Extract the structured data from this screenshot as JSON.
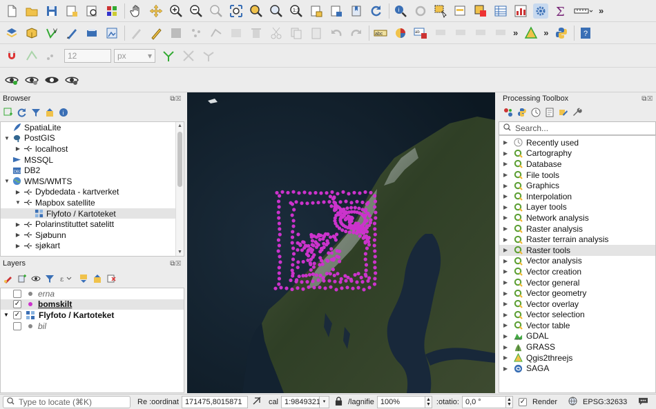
{
  "toolbar3": {
    "size_value": "12",
    "unit": "px"
  },
  "browser": {
    "title": "Browser",
    "items": [
      {
        "label": "SpatiaLite",
        "indent": 0,
        "arrow": "",
        "icon": "spatialite-feather-icon"
      },
      {
        "label": "PostGIS",
        "indent": 0,
        "arrow": "▼",
        "icon": "postgis-elephant-icon"
      },
      {
        "label": "localhost",
        "indent": 1,
        "arrow": "▶",
        "icon": "connection-icon"
      },
      {
        "label": "MSSQL",
        "indent": 0,
        "arrow": "",
        "icon": "mssql-icon"
      },
      {
        "label": "DB2",
        "indent": 0,
        "arrow": "",
        "icon": "db2-icon"
      },
      {
        "label": "WMS/WMTS",
        "indent": 0,
        "arrow": "▼",
        "icon": "wms-globe-icon"
      },
      {
        "label": "Dybdedata - kartverket",
        "indent": 1,
        "arrow": "▶",
        "icon": "connection-icon"
      },
      {
        "label": "Mapbox satellite",
        "indent": 1,
        "arrow": "▼",
        "icon": "connection-icon"
      },
      {
        "label": "Flyfoto / Kartoteket",
        "indent": 2,
        "arrow": "",
        "icon": "raster-layer-icon"
      },
      {
        "label": "Polarinstituttet satelitt",
        "indent": 1,
        "arrow": "▶",
        "icon": "connection-icon"
      },
      {
        "label": "Sjøbunn",
        "indent": 1,
        "arrow": "▶",
        "icon": "connection-icon"
      },
      {
        "label": "sjøkart",
        "indent": 1,
        "arrow": "▶",
        "icon": "connection-icon"
      }
    ]
  },
  "layers": {
    "title": "Layers",
    "items": [
      {
        "label": "erna",
        "checked": false,
        "style": "italic",
        "color": "#888888",
        "arrow": "",
        "type": "point"
      },
      {
        "label": "bomskilt",
        "checked": true,
        "style": "bold",
        "color": "#cc33cc",
        "arrow": "",
        "type": "point"
      },
      {
        "label": "Flyfoto / Kartoteket",
        "checked": true,
        "style": "bold",
        "color": "",
        "arrow": "▼",
        "type": "raster"
      },
      {
        "label": "bil",
        "checked": false,
        "style": "italic",
        "color": "#888888",
        "arrow": "",
        "type": "point"
      }
    ]
  },
  "toolbox": {
    "title": "Processing Toolbox",
    "search_placeholder": "Search...",
    "items": [
      {
        "label": "Recently used",
        "icon": "clock-icon"
      },
      {
        "label": "Cartography",
        "icon": "qgis-q-icon"
      },
      {
        "label": "Database",
        "icon": "qgis-q-icon"
      },
      {
        "label": "File tools",
        "icon": "qgis-q-icon"
      },
      {
        "label": "Graphics",
        "icon": "qgis-q-icon"
      },
      {
        "label": "Interpolation",
        "icon": "qgis-q-icon"
      },
      {
        "label": "Layer tools",
        "icon": "qgis-q-icon"
      },
      {
        "label": "Network analysis",
        "icon": "qgis-q-icon"
      },
      {
        "label": "Raster analysis",
        "icon": "qgis-q-icon"
      },
      {
        "label": "Raster terrain analysis",
        "icon": "qgis-q-icon"
      },
      {
        "label": "Raster tools",
        "icon": "qgis-q-icon",
        "selected": true
      },
      {
        "label": "Vector analysis",
        "icon": "qgis-q-icon"
      },
      {
        "label": "Vector creation",
        "icon": "qgis-q-icon"
      },
      {
        "label": "Vector general",
        "icon": "qgis-q-icon"
      },
      {
        "label": "Vector geometry",
        "icon": "qgis-q-icon"
      },
      {
        "label": "Vector overlay",
        "icon": "qgis-q-icon"
      },
      {
        "label": "Vector selection",
        "icon": "qgis-q-icon"
      },
      {
        "label": "Vector table",
        "icon": "qgis-q-icon"
      },
      {
        "label": "GDAL",
        "icon": "gdal-icon"
      },
      {
        "label": "GRASS",
        "icon": "grass-icon"
      },
      {
        "label": "Qgis2threejs",
        "icon": "qgis2threejs-icon"
      },
      {
        "label": "SAGA",
        "icon": "saga-icon"
      }
    ]
  },
  "statusbar": {
    "locate_placeholder": "Type to locate (⌘K)",
    "coordinate_label": "Re :oordinat",
    "coordinate_value": "171475,8015871",
    "scale_label": "cal",
    "scale_value": "1:9849321",
    "magnifier_label": "/lagnifie",
    "magnifier_value": "100%",
    "rotation_label": ":otatio:",
    "rotation_value": "0,0 °",
    "render_label": "Render",
    "render_checked": true,
    "crs_label": "EPSG:32633"
  },
  "colors": {
    "accent": "#cc33cc",
    "selection": "#e4e4e4"
  }
}
